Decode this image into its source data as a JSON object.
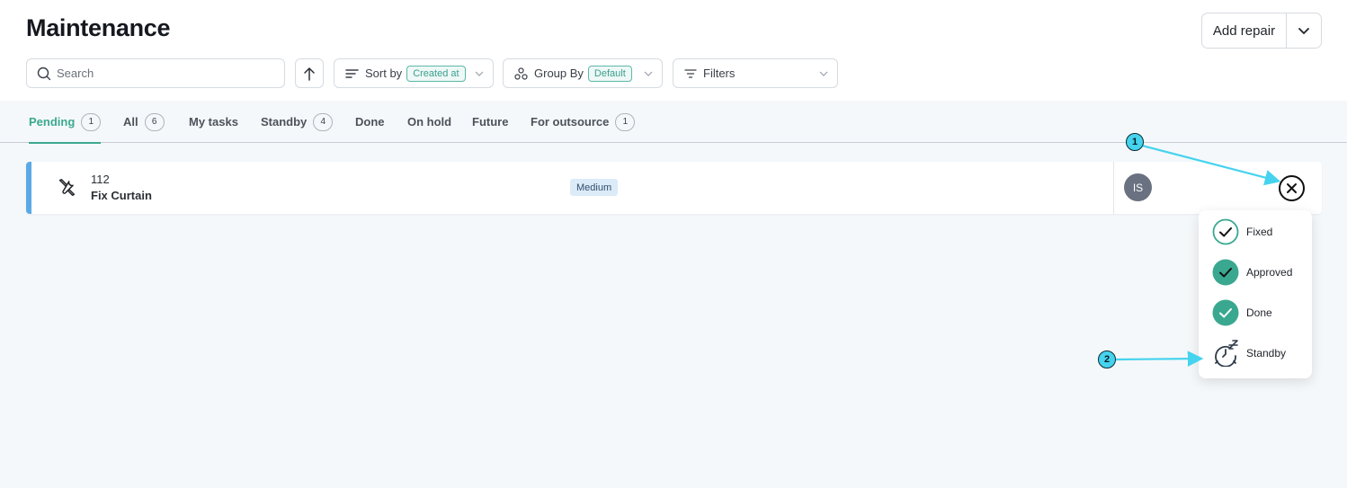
{
  "header": {
    "title": "Maintenance",
    "add_repair_label": "Add repair"
  },
  "toolbar": {
    "search_placeholder": "Search",
    "sort_label": "Sort by",
    "sort_value": "Created at",
    "group_label": "Group By",
    "group_value": "Default",
    "filters_label": "Filters"
  },
  "tabs": [
    {
      "label": "Pending",
      "count": "1",
      "active": true
    },
    {
      "label": "All",
      "count": "6"
    },
    {
      "label": "My tasks"
    },
    {
      "label": "Standby",
      "count": "4"
    },
    {
      "label": "Done"
    },
    {
      "label": "On hold"
    },
    {
      "label": "Future"
    },
    {
      "label": "For outsource",
      "count": "1"
    }
  ],
  "task": {
    "number": "112",
    "title": "Fix Curtain",
    "priority": "Medium",
    "assignee_initials": "IS",
    "accent_color": "#5aa9e6"
  },
  "status_menu": {
    "items": [
      {
        "label": "Fixed",
        "icon": "check-outline-icon"
      },
      {
        "label": "Approved",
        "icon": "check-filled-icon"
      },
      {
        "label": "Done",
        "icon": "check-filled-icon"
      },
      {
        "label": "Standby",
        "icon": "snooze-clock-icon"
      }
    ]
  },
  "annotations": {
    "marker_1": "1",
    "marker_2": "2"
  },
  "colors": {
    "accent": "#3aa890",
    "marker": "#45d3ee"
  }
}
